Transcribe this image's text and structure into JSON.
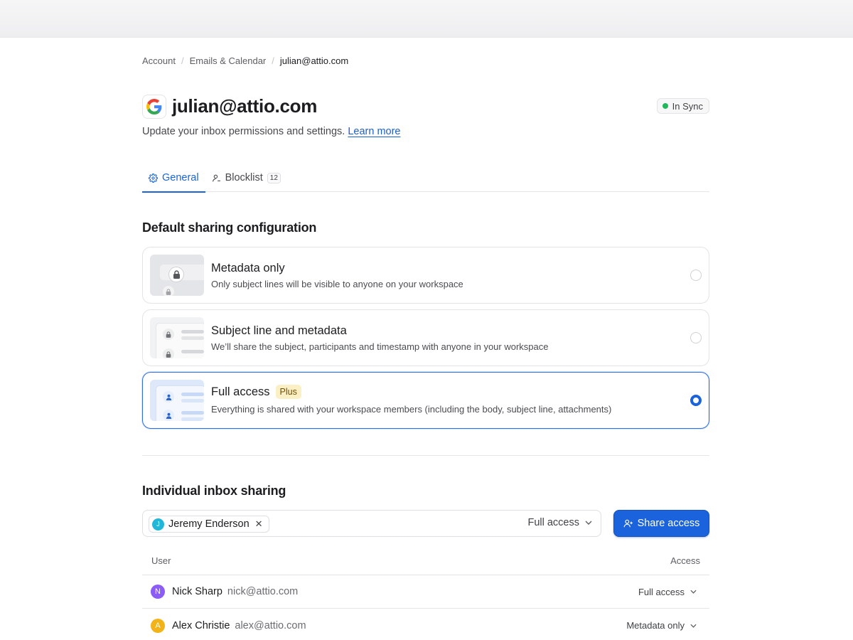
{
  "breadcrumb": [
    "Account",
    "Emails & Calendar",
    "julian@attio.com"
  ],
  "header": {
    "title": "julian@attio.com",
    "status": "In Sync",
    "status_color": "#1fb85a",
    "subtitle": "Update your inbox permissions and settings.",
    "learn_more": "Learn more"
  },
  "tabs": [
    {
      "label": "General",
      "icon": "gear-icon",
      "active": true
    },
    {
      "label": "Blocklist",
      "icon": "user-block-icon",
      "count": "12",
      "active": false
    }
  ],
  "default_sharing": {
    "title": "Default sharing configuration",
    "options": [
      {
        "title": "Metadata only",
        "description": "Only subject lines will be visible to anyone on your workspace",
        "selected": false
      },
      {
        "title": "Subject line and metadata",
        "description": "We’ll share the subject, participants and timestamp with anyone in your workspace",
        "selected": false
      },
      {
        "title": "Full access",
        "badge": "Plus",
        "description": "Everything is shared with your workspace members (including the body, subject line, attachments)",
        "selected": true
      }
    ]
  },
  "individual_sharing": {
    "title": "Individual inbox sharing",
    "chip": {
      "initial": "J",
      "name": "Jeremy Enderson"
    },
    "access_value": "Full access",
    "share_button": "Share access",
    "columns": {
      "user": "User",
      "access": "Access"
    },
    "rows": [
      {
        "initial": "N",
        "name": "Nick Sharp",
        "email": "nick@attio.com",
        "access": "Full access",
        "avatar_color": "#8b5cf6"
      },
      {
        "initial": "A",
        "name": "Alex Christie",
        "email": "alex@attio.com",
        "access": "Metadata only",
        "avatar_color": "#f2b318"
      }
    ]
  },
  "colors": {
    "accent": "#1a63dc",
    "plus_badge": "#fbefc4"
  }
}
